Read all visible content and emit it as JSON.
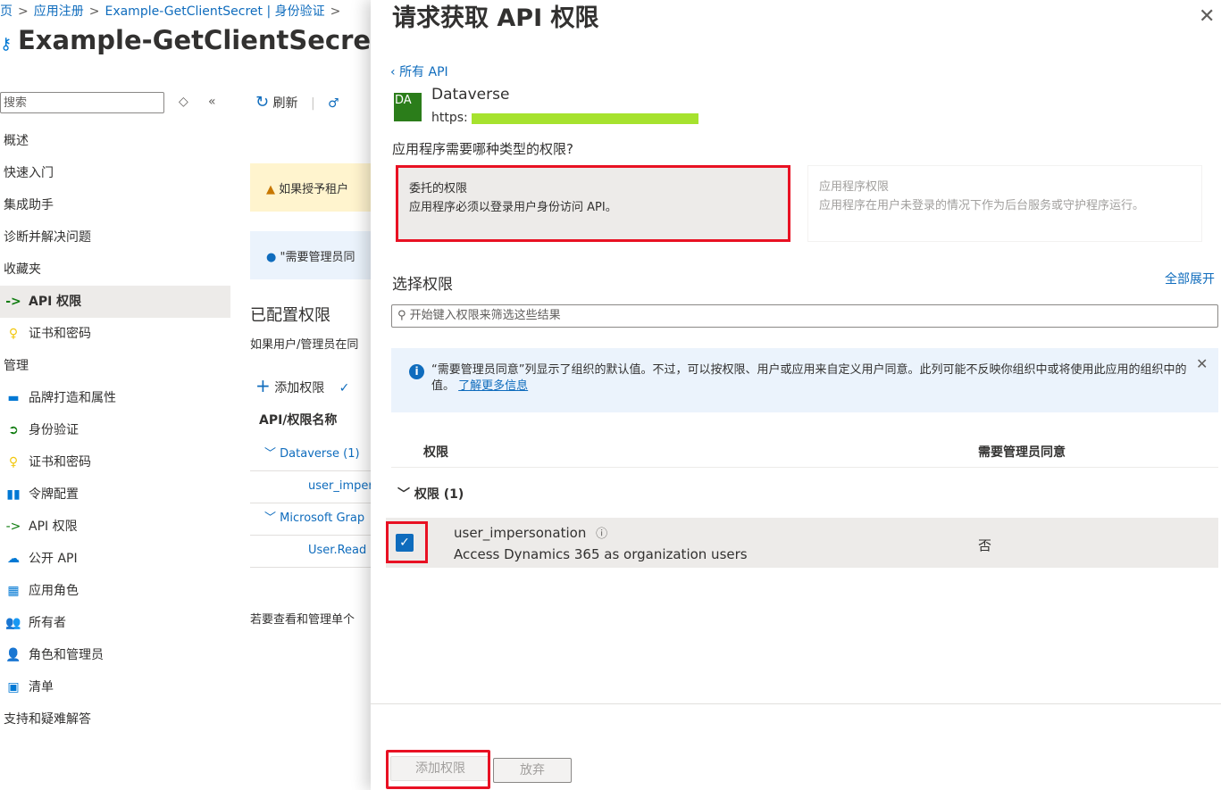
{
  "breadcrumb": {
    "items": [
      "页",
      "应用注册",
      "Example-GetClientSecret | 身份验证"
    ]
  },
  "background_page": {
    "title": "Example-GetClientSecret | API",
    "search_placeholder": "搜索",
    "nav": {
      "items": [
        {
          "label": "概述"
        },
        {
          "label": "快速入门"
        },
        {
          "label": "集成助手"
        },
        {
          "label": "诊断并解决问题"
        },
        {
          "label": "收藏夹"
        },
        {
          "label": "API 权限"
        },
        {
          "label": "证书和密码"
        },
        {
          "label": "管理"
        },
        {
          "label": "品牌打造和属性"
        },
        {
          "label": "身份验证"
        },
        {
          "label": "证书和密码"
        },
        {
          "label": "令牌配置"
        },
        {
          "label": "API 权限"
        },
        {
          "label": "公开 API"
        },
        {
          "label": "应用角色"
        },
        {
          "label": "所有者"
        },
        {
          "label": "角色和管理员"
        },
        {
          "label": "清单"
        },
        {
          "label": "支持和疑难解答"
        }
      ]
    },
    "toolbar": {
      "refresh": "刷新"
    },
    "warning_text": "如果授予租户",
    "info_text": "\"需要管理员同",
    "configured_title": "已配置权限",
    "configured_desc": "如果用户/管理员在同",
    "add_permission": "添加权限",
    "table_header": "API/权限名称",
    "rows": {
      "dataverse": "Dataverse (1)",
      "user_imper": "user_imper",
      "graph": "Microsoft Grap",
      "user_read": "User.Read"
    },
    "bottom_note": "若要查看和管理单个"
  },
  "panel": {
    "title": "请求获取 API 权限",
    "back_link": "所有 API",
    "api": {
      "logo_text": "DA",
      "name": "Dataverse",
      "url_prefix": "https:"
    },
    "question": "应用程序需要哪种类型的权限?",
    "delegated": {
      "title": "委托的权限",
      "desc": "应用程序必须以登录用户身份访问 API。"
    },
    "application": {
      "title": "应用程序权限",
      "desc": "应用程序在用户未登录的情况下作为后台服务或守护程序运行。"
    },
    "select_title": "选择权限",
    "expand_all": "全部展开",
    "filter_placeholder": "开始键入权限来筛选这些结果",
    "info_message": "“需要管理员同意”列显示了组织的默认值。不过，可以按权限、用户或应用来自定义用户同意。此列可能不反映你组织中或将使用此应用的组织中的值。",
    "learn_more": "了解更多信息",
    "col_permission": "权限",
    "col_admin_consent": "需要管理员同意",
    "group_label": "权限 (1)",
    "permission": {
      "name": "user_impersonation",
      "desc": "Access Dynamics 365 as organization users",
      "admin_consent": "否",
      "checked": true
    },
    "buttons": {
      "add": "添加权限",
      "discard": "放弃"
    }
  },
  "colors": {
    "accent": "#0f6cbd",
    "highlight": "#e81123",
    "warning_bg": "#fff4ce",
    "info_bg": "#ebf3fc"
  }
}
